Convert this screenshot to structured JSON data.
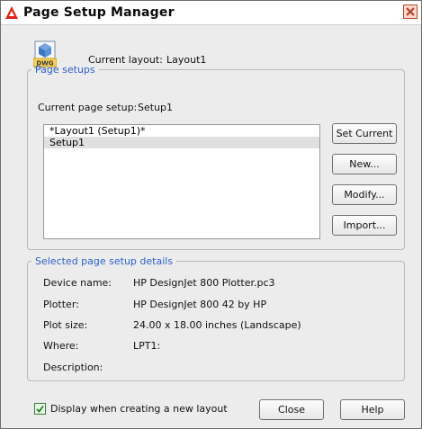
{
  "window": {
    "title": "Page Setup Manager"
  },
  "header": {
    "current_layout_label": "Current layout:",
    "current_layout_value": "Layout1"
  },
  "page_setups": {
    "legend": "Page setups",
    "current_setup_label": "Current page setup:",
    "current_setup_value": "Setup1",
    "items": [
      "*Layout1 (Setup1)*",
      "Setup1"
    ],
    "buttons": {
      "set_current": "Set Current",
      "new": "New...",
      "modify": "Modify...",
      "import": "Import..."
    }
  },
  "details": {
    "legend": "Selected page setup details",
    "device_name_label": "Device name:",
    "device_name_value": "HP DesignJet 800 Plotter.pc3",
    "plotter_label": "Plotter:",
    "plotter_value": "HP DesignJet 800 42 by HP",
    "plot_size_label": "Plot size:",
    "plot_size_value": "24.00 x 18.00 inches (Landscape)",
    "where_label": "Where:",
    "where_value": "LPT1:",
    "description_label": "Description:",
    "description_value": ""
  },
  "footer": {
    "checkbox_label": "Display when creating a new layout",
    "close_label": "Close",
    "help_label": "Help"
  },
  "icons": {
    "app_icon": "autocad-icon",
    "close_icon": "close-icon",
    "dwg_icon": "dwg-file-icon",
    "checkbox_icon": "checkmark-icon"
  }
}
